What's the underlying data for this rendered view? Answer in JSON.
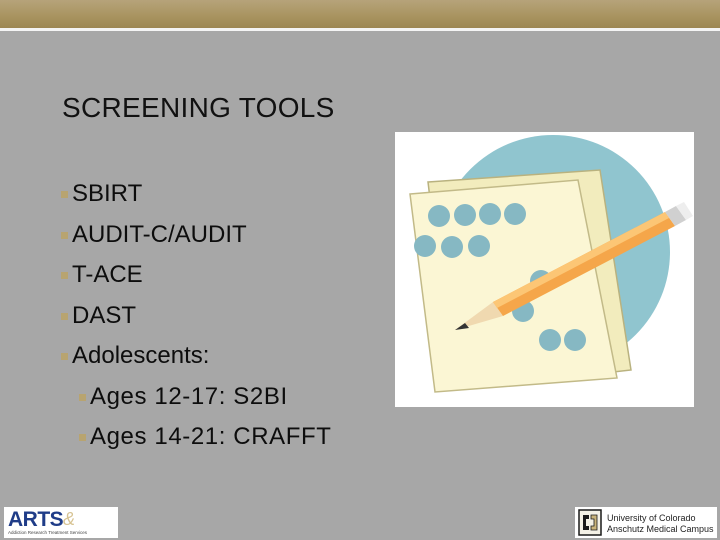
{
  "slide": {
    "title": "SCREENING TOOLS",
    "bullets": [
      {
        "text": "SBIRT",
        "level": 1
      },
      {
        "text": "AUDIT-C/AUDIT",
        "level": 1
      },
      {
        "text": "T-ACE",
        "level": 1
      },
      {
        "text": "DAST",
        "level": 1
      },
      {
        "text": "Adolescents:",
        "level": 1
      },
      {
        "text": "Ages 12-17: S2BI",
        "level": 2
      },
      {
        "text": "Ages 14-21: CRAFFT",
        "level": 2
      }
    ]
  },
  "logos": {
    "arts": {
      "wordmark": "ARTS",
      "ampersand": "&",
      "subtitle": "Addiction Research   Treatment Services"
    },
    "cu": {
      "line1": "University of Colorado",
      "line2": "Anschutz Medical Campus"
    }
  },
  "clipart": {
    "icon": "checklist-with-pencil-icon"
  },
  "colors": {
    "background": "#a7a7a7",
    "topbar": "#a8935f",
    "bullet_marker": "#b8a470",
    "title_text": "#111111",
    "arts_blue": "#1f3c88"
  }
}
